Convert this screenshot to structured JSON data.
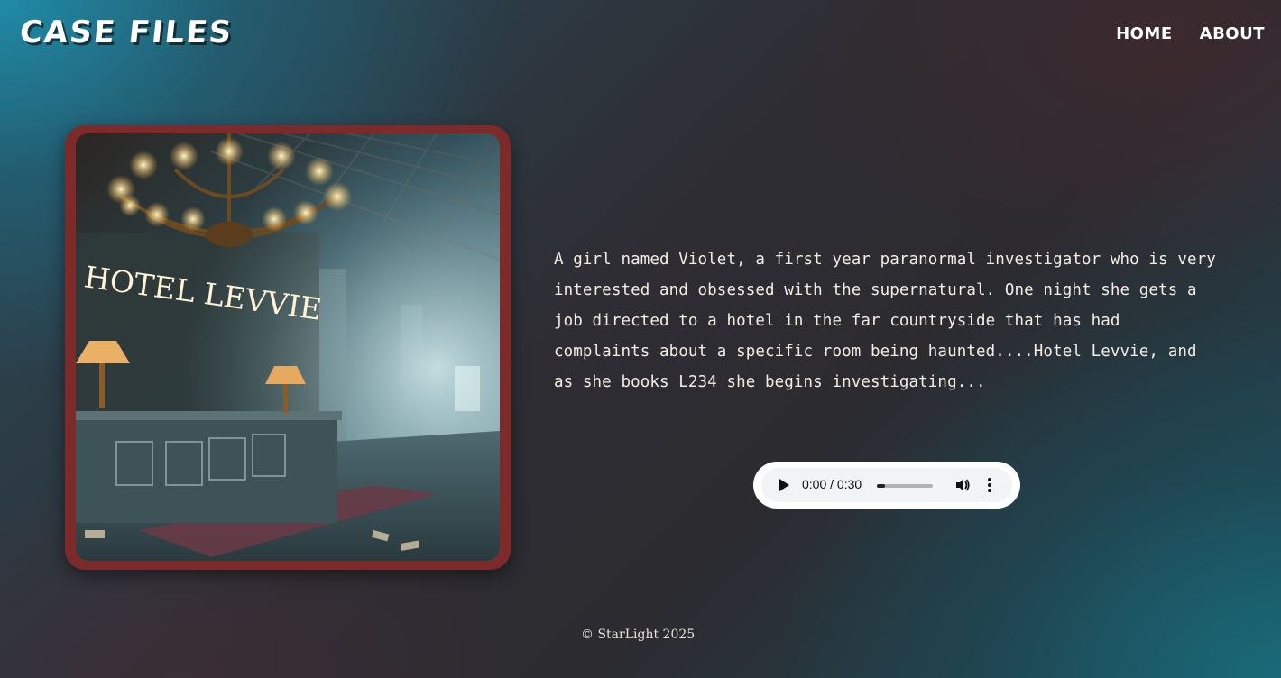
{
  "header": {
    "brand": "CASE FILES",
    "nav": [
      {
        "label": "HOME"
      },
      {
        "label": "ABOUT"
      }
    ]
  },
  "image": {
    "sign_text": "HOTEL LEVVIE"
  },
  "story": {
    "text": "A girl named Violet, a first year paranormal investigator who is very interested and obsessed with the supernatural. One night she gets a job directed to a hotel in the far countryside that has had complaints about a specific room being haunted....Hotel Levvie, and as she books L234 she begins investigating..."
  },
  "audio": {
    "time": "0:00 / 0:30",
    "progress": 0.15,
    "play_icon": "play-icon",
    "volume_icon": "volume-icon",
    "menu_icon": "more-vertical-icon"
  },
  "footer": {
    "text": "© StarLight 2025"
  },
  "colors": {
    "frame": "#7d2a2a",
    "text": "#f4ede4"
  }
}
